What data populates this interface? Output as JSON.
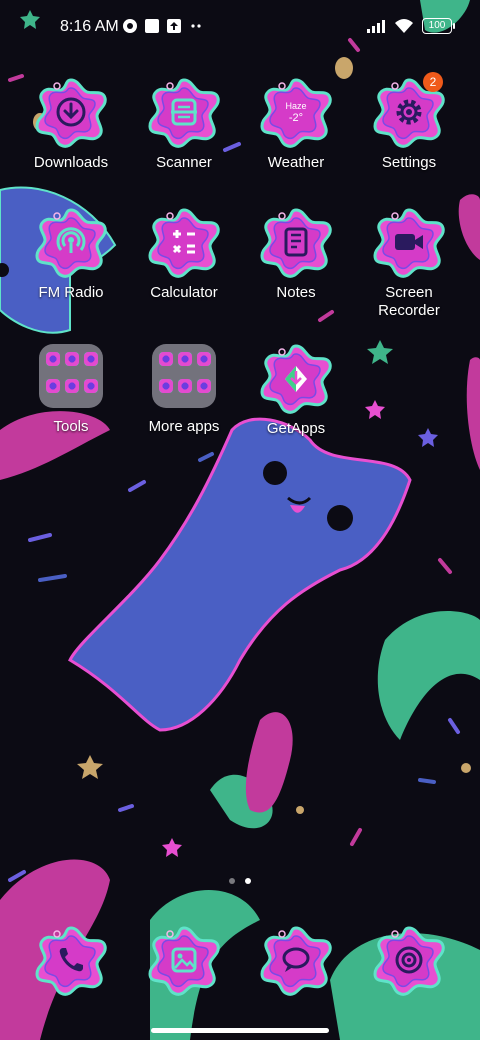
{
  "status_bar": {
    "time": "8:16 AM",
    "battery": "100",
    "icons": [
      "flower-status-icon",
      "square-status-icon",
      "upload-status-icon",
      "more-dots-icon",
      "signal-icon",
      "wifi-icon",
      "battery-icon"
    ]
  },
  "apps": [
    {
      "name": "downloads",
      "label": "Downloads",
      "icon": "download-icon"
    },
    {
      "name": "scanner",
      "label": "Scanner",
      "icon": "scanner-icon"
    },
    {
      "name": "weather",
      "label": "Weather",
      "icon": "weather-icon",
      "condition": "Haze",
      "temp": "-2°"
    },
    {
      "name": "settings",
      "label": "Settings",
      "icon": "gear-icon",
      "badge": "2"
    },
    {
      "name": "fm-radio",
      "label": "FM Radio",
      "icon": "radio-icon"
    },
    {
      "name": "calculator",
      "label": "Calculator",
      "icon": "calculator-icon"
    },
    {
      "name": "notes",
      "label": "Notes",
      "icon": "notes-icon"
    },
    {
      "name": "screen-recorder",
      "label": "Screen\nRecorder",
      "icon": "video-camera-icon"
    },
    {
      "name": "tools-folder",
      "label": "Tools",
      "icon": "folder-icon"
    },
    {
      "name": "more-apps-folder",
      "label": "More apps",
      "icon": "folder-icon"
    },
    {
      "name": "getapps",
      "label": "GetApps",
      "icon": "getapps-icon"
    }
  ],
  "dock": [
    {
      "name": "phone",
      "icon": "phone-icon"
    },
    {
      "name": "gallery",
      "icon": "gallery-icon"
    },
    {
      "name": "messages",
      "icon": "chat-bubble-icon"
    },
    {
      "name": "camera",
      "icon": "camera-icon"
    }
  ],
  "pages": {
    "count": 2,
    "active": 2
  },
  "colors": {
    "background": "#0c0b14",
    "icon_pink": "#e84fd1",
    "icon_outline": "#5fe3c9",
    "icon_center": "#6a3ad8",
    "cat_blue": "#4a5fc4",
    "badge": "#f05a1a"
  }
}
